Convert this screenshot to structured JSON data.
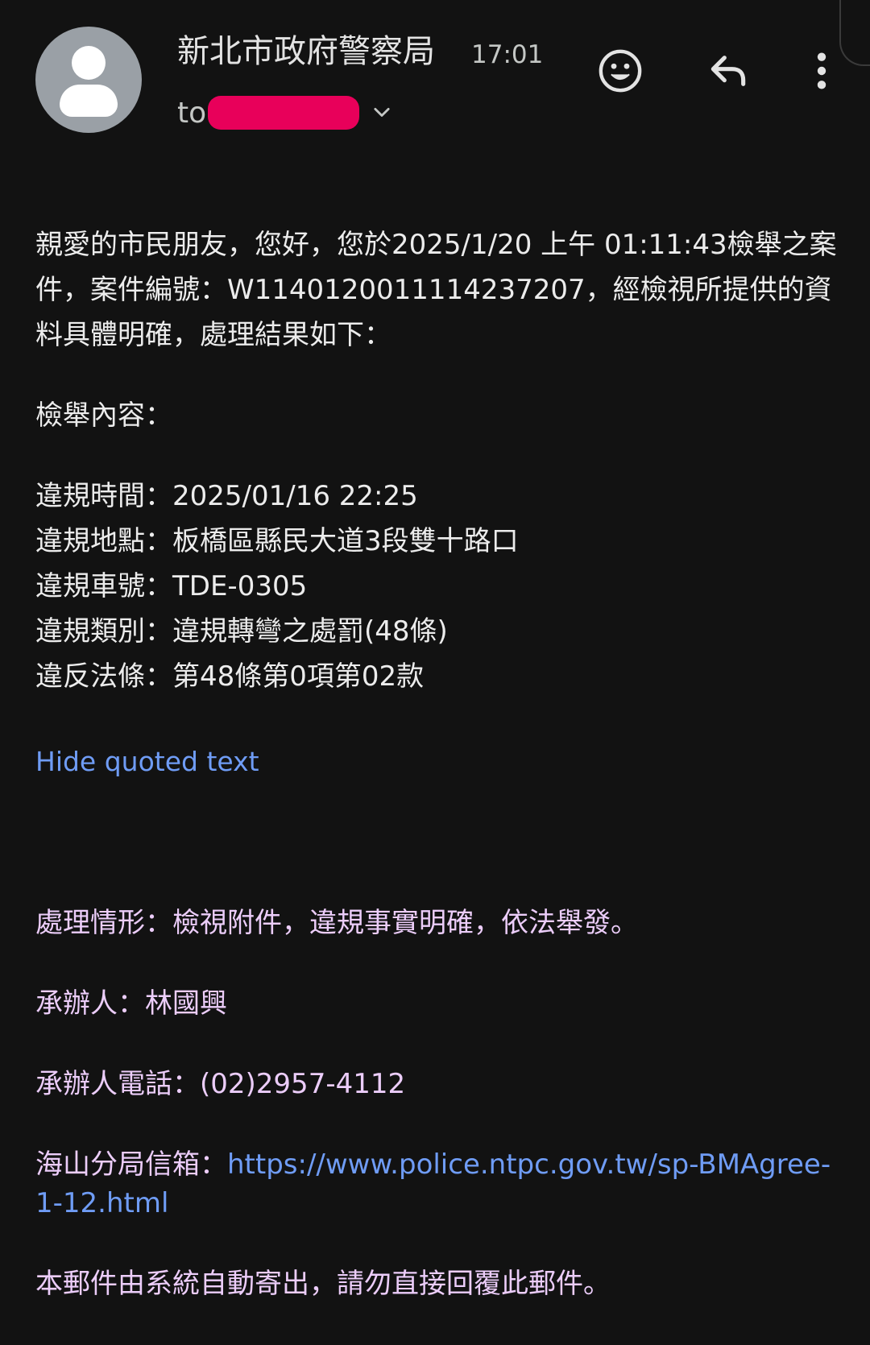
{
  "header": {
    "sender_name": "新北市政府警察局",
    "time": "17:01",
    "to_label": "to",
    "icons": {
      "avatar": "person-icon",
      "expand": "chevron-down-icon",
      "emoji": "emoji-smile-icon",
      "reply": "reply-icon",
      "more": "more-vert-icon"
    },
    "redaction_color": "#e8005a"
  },
  "body": {
    "intro": "親愛的市民朋友，您好，您於2025/1/20 上午 01:11:43檢舉之案件，案件編號：W1140120011114237207，經檢視所提供的資料具體明確，處理結果如下：",
    "report_heading": "檢舉內容：",
    "details": [
      "違規時間：2025/01/16 22:25",
      "違規地點：板橋區縣民大道3段雙十路口",
      "違規車號：TDE-0305",
      "違規類別：違規轉彎之處罰(48條)",
      "違反法條：第48條第0項第02款"
    ],
    "hide_quoted": "Hide quoted text"
  },
  "quoted": {
    "handling": "處理情形：檢視附件，違規事實明確，依法舉發。",
    "officer": "承辦人：林國興",
    "phone": "承辦人電話：(02)2957-4112",
    "mailbox_label": "海山分局信箱：",
    "mailbox_url": "https://www.police.ntpc.gov.tw/sp-BMAgree-1-12.html",
    "footer": "本郵件由系統自動寄出，請勿直接回覆此郵件。"
  },
  "colors": {
    "background": "#121212",
    "link": "#6f9cf5",
    "quoted_text": "#eccdfa",
    "avatar": "#9aa0a6"
  }
}
